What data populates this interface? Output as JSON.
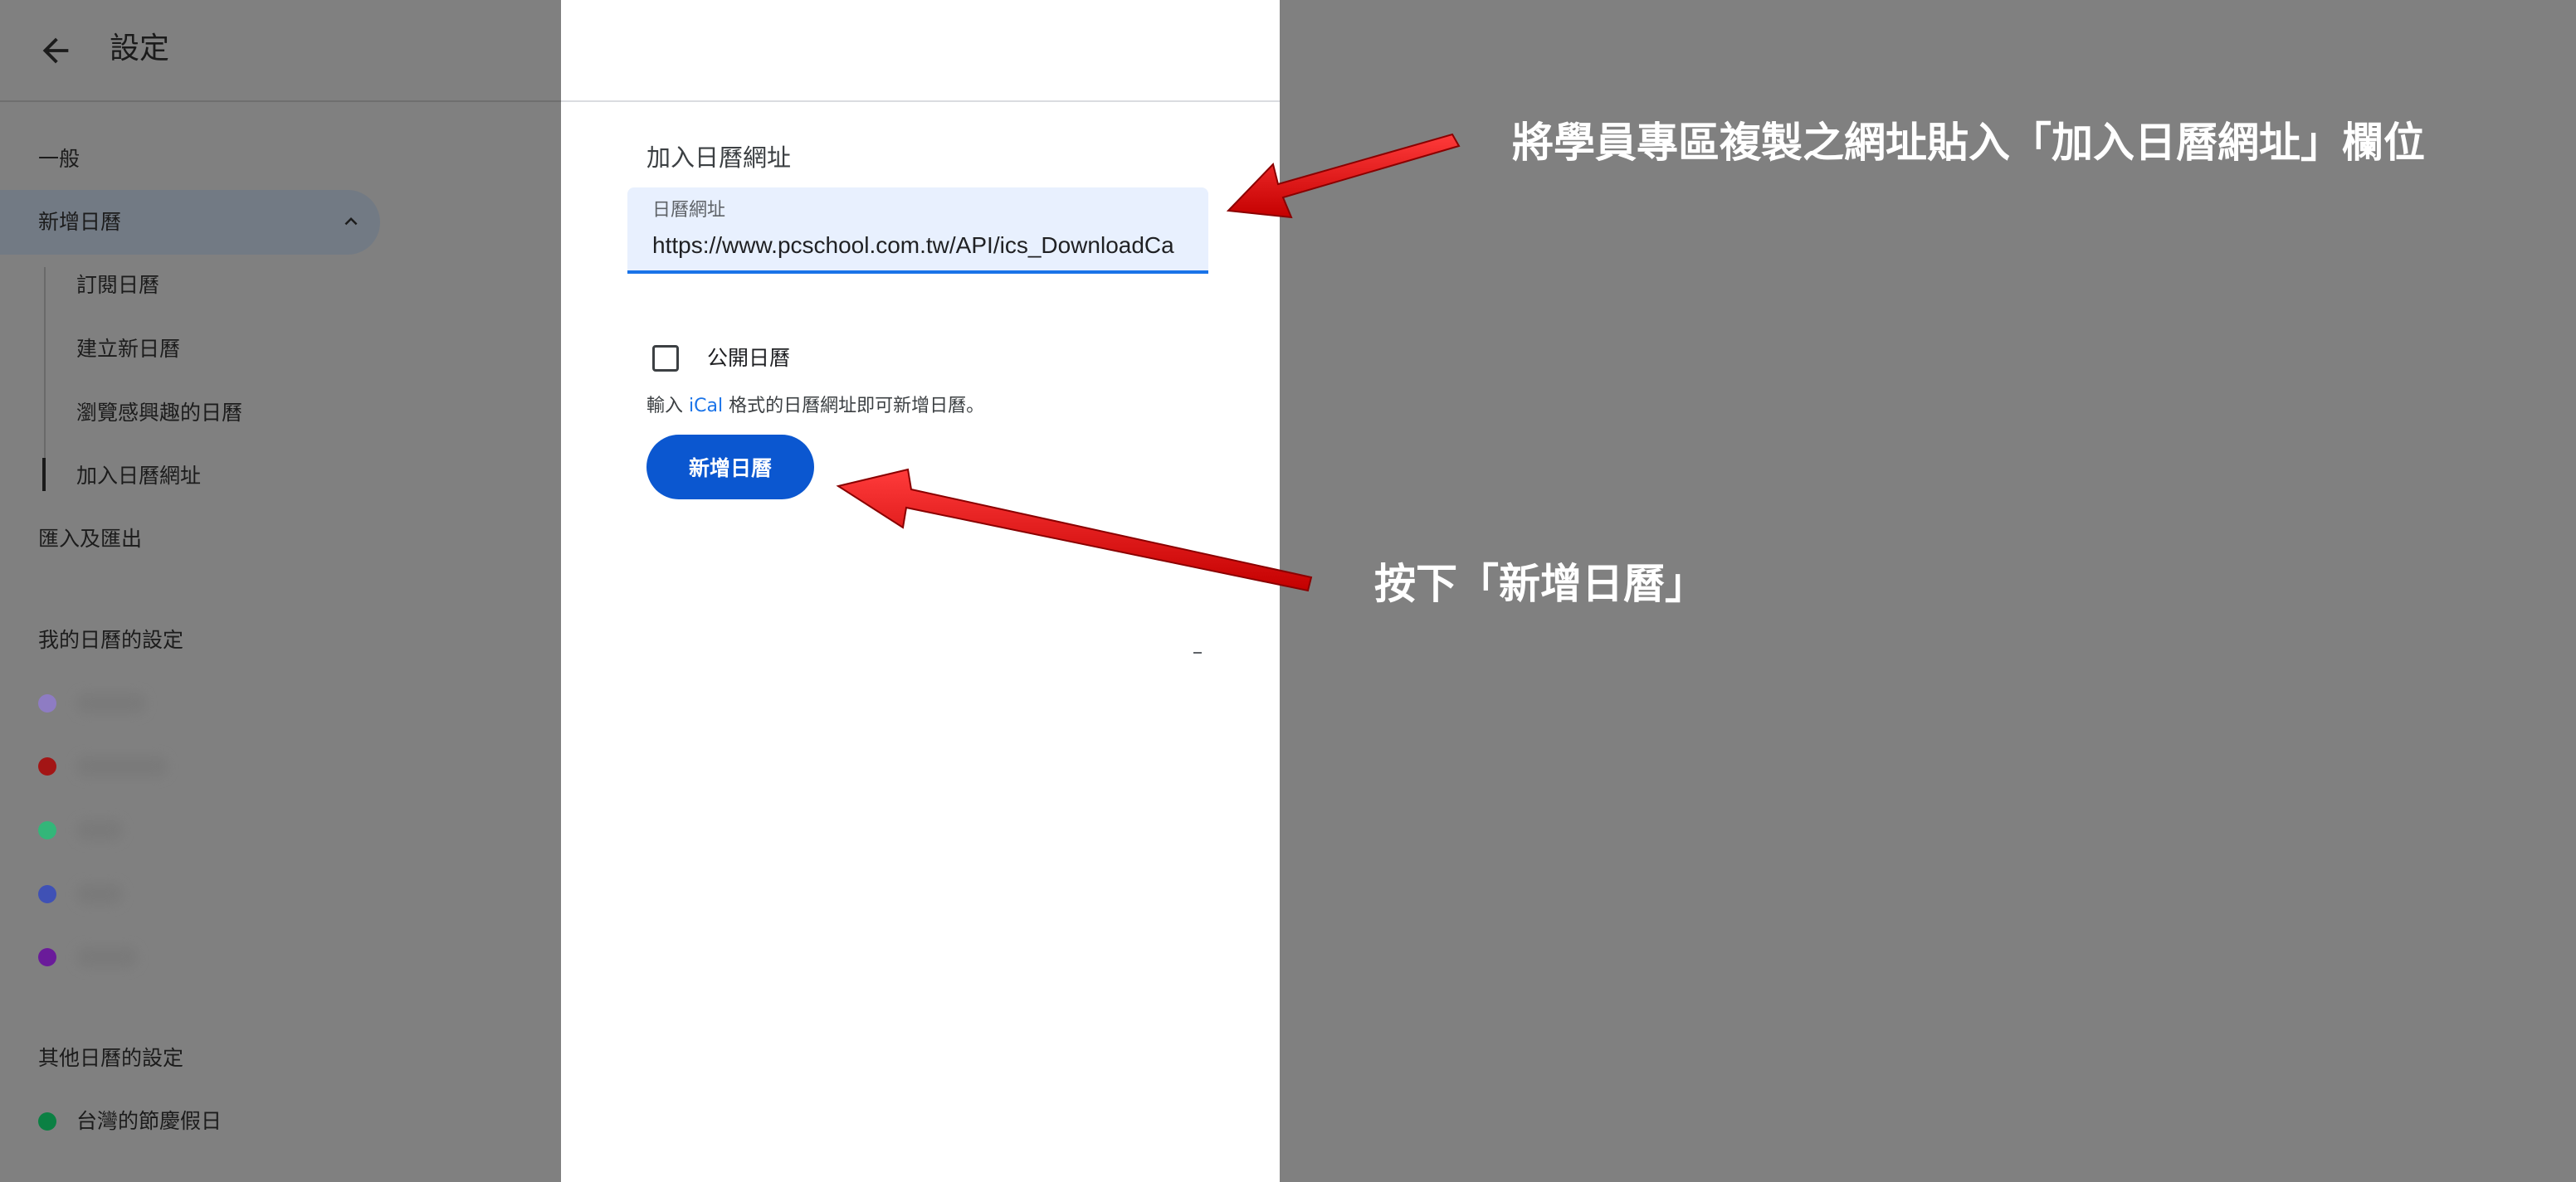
{
  "header": {
    "title": "設定",
    "back_icon": "arrow-back-icon"
  },
  "sidebar": {
    "items": {
      "general": "一般",
      "add_calendar": "新增日曆",
      "subscribe": "訂閱日曆",
      "create_new": "建立新日曆",
      "browse": "瀏覽感興趣的日曆",
      "from_url": "加入日曆網址",
      "import_export": "匯入及匯出"
    },
    "my_calendars_title": "我的日曆的設定",
    "my_calendar_colors": [
      "#8e7cc3",
      "#a31515",
      "#33b679",
      "#3f51b5",
      "#6a1b9a"
    ],
    "other_calendars_title": "其他日曆的設定",
    "other_calendar": {
      "label": "台灣的節慶假日",
      "color": "#0b8043"
    }
  },
  "panel": {
    "section_title": "加入日曆網址",
    "url_field_label": "日曆網址",
    "url_value": "https://www.pcschool.com.tw/API/ics_DownloadCa",
    "public_checkbox_label": "公開日曆",
    "helper_prefix": "輸入 ",
    "helper_ical": "iCal",
    "helper_suffix": " 格式的日曆網址即可新增日曆。",
    "add_button_label": "新增日曆"
  },
  "annotations": {
    "paste_instruction": "將學員專區複製之網址貼入「加入日曆網址」欄位",
    "press_instruction": "按下「新增日曆」",
    "arrow_color": "#e8141b"
  },
  "colors": {
    "accent_blue": "#0b57d0",
    "field_bg": "#e8f0fe",
    "overlay_gray": "#808080"
  }
}
